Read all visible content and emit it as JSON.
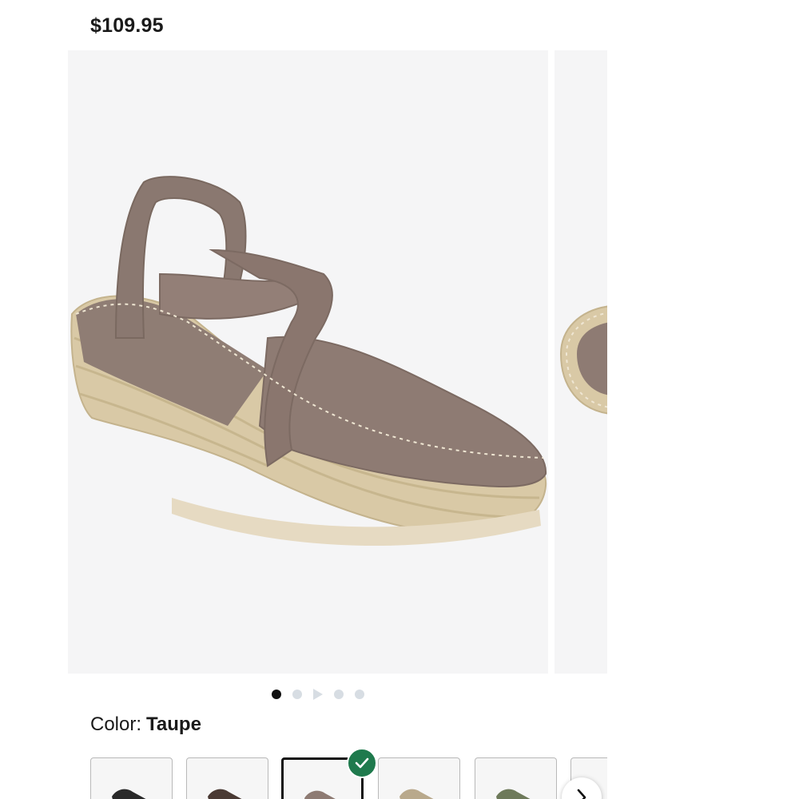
{
  "product": {
    "price": "$109.95"
  },
  "gallery": {
    "image_count": 5,
    "active_index": 0,
    "dots": [
      "image",
      "image",
      "video",
      "image",
      "image"
    ]
  },
  "color": {
    "label": "Color:",
    "selected": "Taupe"
  },
  "swatches": [
    {
      "name": "black",
      "hex": "#2a2a2a",
      "selected": false
    },
    {
      "name": "brown",
      "hex": "#4a3a34",
      "selected": false
    },
    {
      "name": "taupe",
      "hex": "#8e7b73",
      "selected": true
    },
    {
      "name": "sand",
      "hex": "#b9a98c",
      "selected": false
    },
    {
      "name": "olive",
      "hex": "#6e7a5a",
      "selected": false
    },
    {
      "name": "partial",
      "hex": "#c9c2b8",
      "selected": false
    }
  ],
  "colors": {
    "accent_check": "#1f7a4d",
    "image_bg": "#f5f5f6"
  },
  "icons": {
    "selected_check": "check-icon",
    "carousel_next": "chevron-right-icon"
  }
}
